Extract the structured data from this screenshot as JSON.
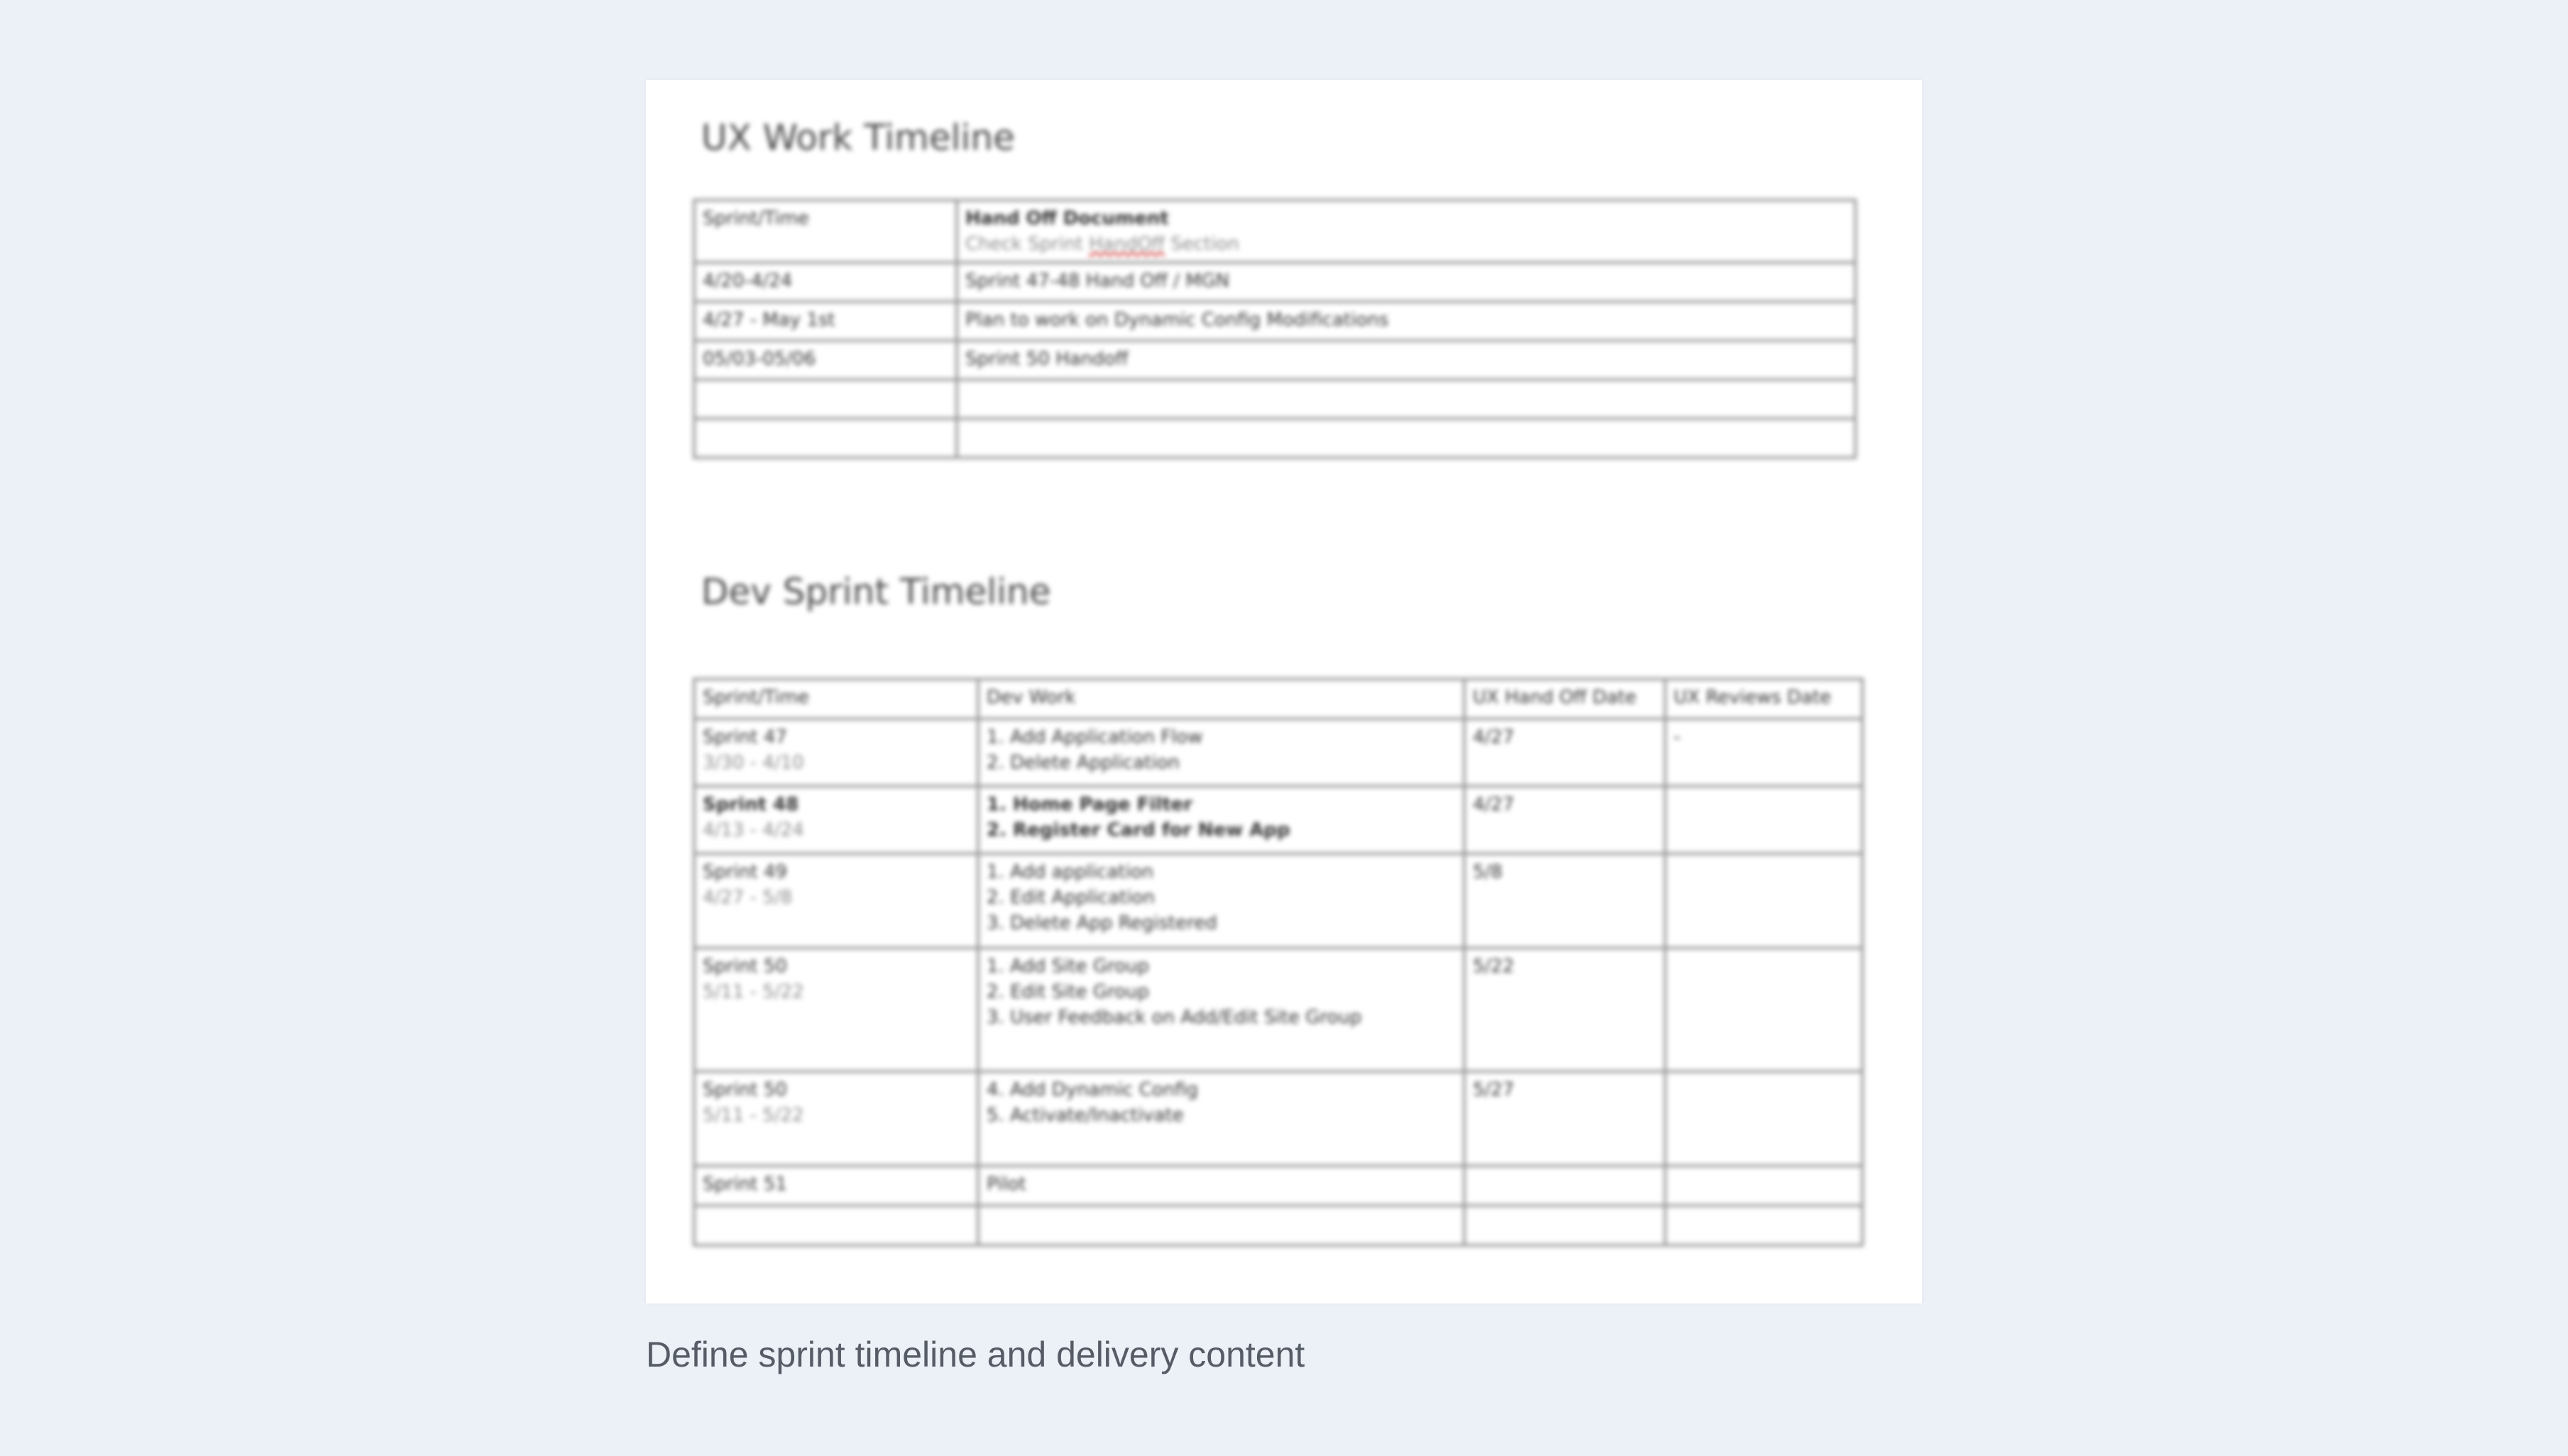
{
  "document": {
    "ux_title": "UX Work Timeline",
    "ux_table": {
      "header": {
        "col1": "Sprint/Time",
        "col2_title": "Hand Off Document",
        "col2_note_prefix": "Check Sprint ",
        "col2_note_link": "HandOff",
        "col2_note_suffix": " Section"
      },
      "rows": [
        {
          "time": "4/20-4/24",
          "doc": "Sprint 47-48 Hand Off / MGN"
        },
        {
          "time": "4/27 - May 1st",
          "doc": "Plan to work on Dynamic Config Modifications"
        },
        {
          "time": "05/03-05/06",
          "doc": "Sprint 50 Handoff"
        },
        {
          "time": "",
          "doc": ""
        },
        {
          "time": "",
          "doc": ""
        }
      ]
    },
    "dev_title": "Dev Sprint Timeline",
    "dev_table": {
      "headers": [
        "Sprint/Time",
        "Dev Work",
        "UX Hand Off Date",
        "UX Reviews Date"
      ],
      "rows": [
        {
          "sprint": "Sprint 47",
          "dates": "3/30 - 4/10",
          "work": [
            "1. Add Application Flow",
            "2. Delete Application"
          ],
          "handoff": "4/27",
          "review": "-"
        },
        {
          "sprint": "Sprint 48",
          "dates": "4/13 - 4/24",
          "work": [
            "1. Home Page Filter",
            "2. Register Card for New App"
          ],
          "handoff": "4/27",
          "review": ""
        },
        {
          "sprint": "Sprint 49",
          "dates": "4/27 - 5/8",
          "work": [
            "1. Add application",
            "2. Edit Application",
            "3. Delete App Registered"
          ],
          "handoff": "5/8",
          "review": ""
        },
        {
          "sprint": "Sprint 50",
          "dates": "5/11 - 5/22",
          "work": [
            "1. Add Site Group",
            "2. Edit Site Group",
            "3. User Feedback on Add/Edit Site Group"
          ],
          "handoff": "5/22",
          "review": ""
        },
        {
          "sprint": "Sprint 50",
          "dates": "5/11 - 5/22",
          "work": [
            "4. Add Dynamic Config",
            "5. Activate/Inactivate"
          ],
          "handoff": "5/27",
          "review": ""
        },
        {
          "sprint": "Sprint 51",
          "dates": "",
          "work": [
            "Pilot"
          ],
          "handoff": "",
          "review": ""
        },
        {
          "sprint": "",
          "dates": "",
          "work": [
            ""
          ],
          "handoff": "",
          "review": ""
        }
      ]
    }
  },
  "caption": "Define sprint timeline and delivery content"
}
